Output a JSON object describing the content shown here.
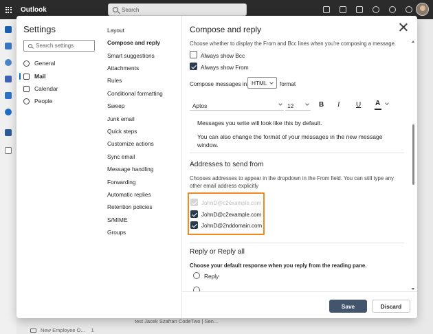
{
  "app": {
    "name": "Outlook",
    "search_placeholder": "Search"
  },
  "background": {
    "row1": "test Jacek Szafran CodeTwo | Sen...",
    "row2_label": "New Employee O...",
    "row2_count": "1"
  },
  "settings": {
    "title": "Settings",
    "search_placeholder": "Search settings",
    "categories": [
      {
        "label": "General",
        "icon": "gear-icon"
      },
      {
        "label": "Mail",
        "icon": "mail-icon"
      },
      {
        "label": "Calendar",
        "icon": "calendar-icon"
      },
      {
        "label": "People",
        "icon": "people-icon"
      }
    ],
    "mail_items": [
      "Layout",
      "Compose and reply",
      "Smart suggestions",
      "Attachments",
      "Rules",
      "Conditional formatting",
      "Sweep",
      "Junk email",
      "Quick steps",
      "Customize actions",
      "Sync email",
      "Message handling",
      "Forwarding",
      "Automatic replies",
      "Retention policies",
      "S/MIME",
      "Groups"
    ]
  },
  "compose": {
    "title": "Compose and reply",
    "from_bcc_desc": "Choose whether to display the From and Bcc lines when you're composing a message.",
    "always_show_bcc": "Always show Bcc",
    "always_show_from": "Always show From",
    "compose_in_label": "Compose messages in",
    "compose_format": "HTML",
    "format_label": "format",
    "font_name": "Aptos",
    "font_size": "12",
    "bold": "B",
    "italic": "I",
    "underline": "U",
    "font_color": "A",
    "preview_line1": "Messages you write will look like this by default.",
    "preview_line2a": "You can also change the format of your messages in the new message",
    "preview_line2b": "window.",
    "addresses_heading": "Addresses to send from",
    "addresses_desc1": "Chooses addresses to appear in the dropdown in the From field. You can still type any",
    "addresses_desc2": "other email address explicitly",
    "addresses": [
      {
        "email": "JohnD@c2example.com",
        "state": "disabled"
      },
      {
        "email": "JohnD@c2example.com",
        "state": "checked"
      },
      {
        "email": "JohnD@2nddomain.com",
        "state": "checked"
      }
    ],
    "reply_heading": "Reply or Reply all",
    "reply_desc": "Choose your default response when you reply from the reading pane.",
    "reply_option": "Reply"
  },
  "footer": {
    "save": "Save",
    "discard": "Discard"
  },
  "colors": {
    "highlight": "#f08a1c",
    "save_button": "#43546d",
    "accent": "#0f6cbd"
  }
}
